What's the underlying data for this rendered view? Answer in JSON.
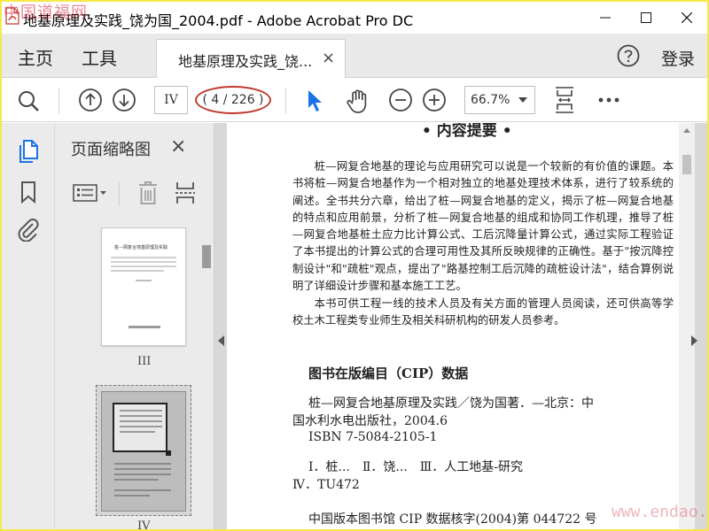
{
  "window": {
    "title": "地基原理及实践_饶为国_2004.pdf - Adobe Acrobat Pro DC",
    "watermark_top_left": "中国道福网",
    "watermark_bottom_right": "www.endao.com"
  },
  "menu": {
    "home": "主页",
    "tools": "工具",
    "tab_label": "地基原理及实践_饶...",
    "tab_close": "×",
    "login": "登录"
  },
  "toolbar": {
    "page_input_value": "IV",
    "page_count": "( 4 / 226 )",
    "zoom": "66.7%"
  },
  "thumbnails": {
    "panel_title": "页面缩略图",
    "close": "×",
    "thumb1_label": "III",
    "thumb2_label": "IV",
    "thumb1_title": "桩—网复合地基原理及实践"
  },
  "document": {
    "heading": "• 内容提要 •",
    "para1": "桩—网复合地基的理论与应用研究可以说是一个较新的有价值的课题。本书将桩—网复合地基作为一个相对独立的地基处理技术体系，进行了较系统的阐述。全书共分六章，给出了桩—网复合地基的定义，揭示了桩—网复合地基的特点和应用前景，分析了桩—网复合地基的组成和协同工作机理，推导了桩—网复合地基桩土应力比计算公式、工后沉降量计算公式，通过实际工程验证了本书提出的计算公式的合理可用性及其所反映规律的正确性。基于\"按沉降控制设计\"和\"疏桩\"观点，提出了\"路基控制工后沉降的疏桩设计法\"，结合算例说明了详细设计步骤和基本施工工艺。",
    "para2": "本书可供工程一线的技术人员及有关方面的管理人员阅读，还可供高等学校土木工程类专业师生及相关科研机构的研发人员参考。",
    "cip_title": "图书在版编目（CIP）数据",
    "cip_line1": "桩—网复合地基原理及实践／饶为国著．—北京：中",
    "cip_line2": "国水利水电出版社，2004.6",
    "cip_line3": "ISBN 7-5084-2105-1",
    "cip_line4": "Ⅰ．桩...　Ⅱ．饶...　Ⅲ．人工地基-研究",
    "cip_line5": "Ⅳ．TU472",
    "cip_line6": "中国版本图书馆 CIP 数据核字(2004)第 044722 号"
  },
  "colors": {
    "accent_blue": "#1a73e8",
    "highlight_red": "#c0392b",
    "frame_yellow": "#f5e94a"
  }
}
